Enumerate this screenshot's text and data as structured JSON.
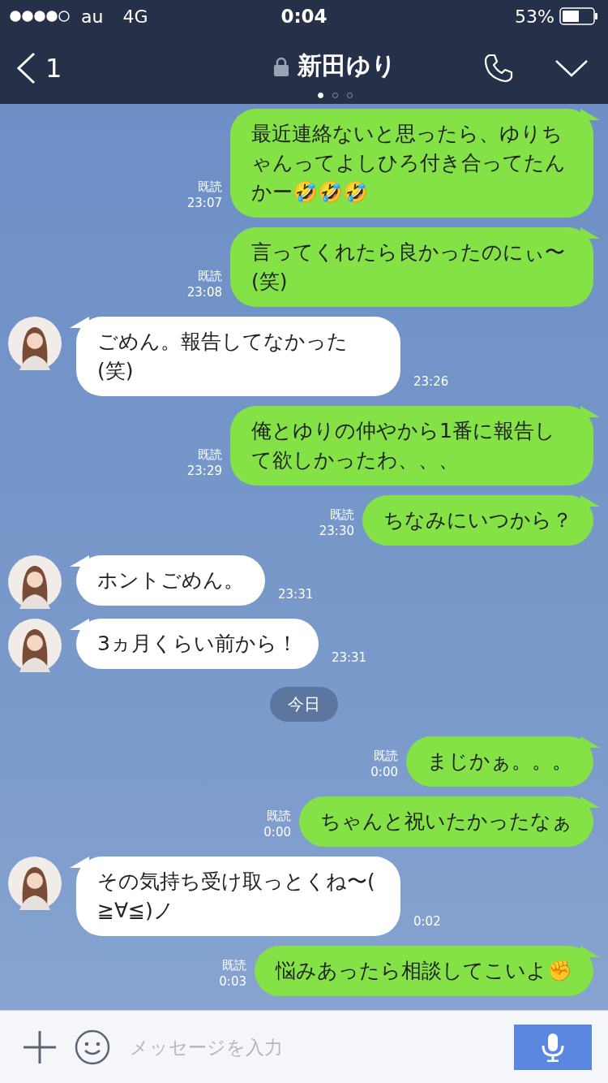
{
  "status_bar": {
    "carrier": "au",
    "network": "4G",
    "time": "0:04",
    "battery": "53%"
  },
  "header": {
    "back_count": "1",
    "title": "新田ゆり",
    "pages": [
      {
        "selected": true
      },
      {
        "selected": false
      },
      {
        "selected": false
      }
    ]
  },
  "messages": [
    {
      "kind": "sent",
      "text": "最近連絡ないと思ったら、ゆりちゃんってよしひろ付き合ってたんかー🤣🤣🤣",
      "read": "既読",
      "time": "23:07"
    },
    {
      "kind": "sent",
      "text": "言ってくれたら良かったのにぃ〜(笑)",
      "read": "既読",
      "time": "23:08"
    },
    {
      "kind": "received",
      "text": "ごめん。報告してなかった(笑)",
      "time": "23:26"
    },
    {
      "kind": "sent",
      "text": "俺とゆりの仲やから1番に報告して欲しかったわ、、、",
      "read": "既読",
      "time": "23:29"
    },
    {
      "kind": "sent",
      "text": "ちなみにいつから？",
      "read": "既読",
      "time": "23:30"
    },
    {
      "kind": "received",
      "text": "ホントごめん。",
      "time": "23:31"
    },
    {
      "kind": "received",
      "text": "3ヵ月くらい前から！",
      "time": "23:31"
    },
    {
      "kind": "date",
      "text": "今日"
    },
    {
      "kind": "sent",
      "text": "まじかぁ。。。",
      "read": "既読",
      "time": "0:00"
    },
    {
      "kind": "sent",
      "text": "ちゃんと祝いたかったなぁ",
      "read": "既読",
      "time": "0:00"
    },
    {
      "kind": "received",
      "text": "その気持ち受け取っとくね〜( ≧∀≦)ノ",
      "time": "0:02"
    },
    {
      "kind": "sent",
      "text": "悩みあったら相談してこいよ✊",
      "read": "既読",
      "time": "0:03"
    }
  ],
  "input": {
    "placeholder": "メッセージを入力"
  }
}
